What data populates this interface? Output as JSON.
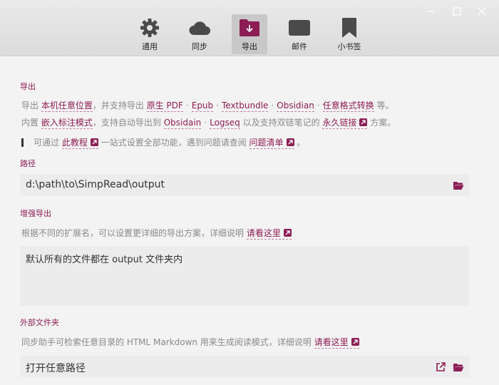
{
  "window": {
    "controls": [
      "minimize",
      "maximize",
      "close"
    ]
  },
  "tabs": [
    {
      "label": "通用",
      "icon": "gear-icon",
      "active": false
    },
    {
      "label": "同步",
      "icon": "cloud-icon",
      "active": false
    },
    {
      "label": "导出",
      "icon": "export-folder-icon",
      "active": true
    },
    {
      "label": "邮件",
      "icon": "mail-icon",
      "active": false
    },
    {
      "label": "小书签",
      "icon": "bookmark-icon",
      "active": false
    }
  ],
  "export": {
    "title": "导出",
    "line1": {
      "prefix": "导出",
      "link1": "本机任意位置",
      "mid": "，并支持导出",
      "formats": [
        "原生 PDF",
        "Epub",
        "Textbundle",
        "Obsidian",
        "任意格式转换"
      ],
      "suffix": "等。"
    },
    "line2": {
      "prefix": "内置",
      "link1": "嵌入标注模式",
      "mid": "，支持自动导出到",
      "link2": "Obsidain",
      "link3": "Logseq",
      "mid2": "以及支持双链笔记的",
      "link4": "永久链接",
      "suffix": "方案。"
    },
    "line3": {
      "prefix": "可通过",
      "link1": "此教程",
      "mid": "一站式设置全部功能，遇到问题请查阅",
      "link2": "问题清单",
      "suffix": "。"
    }
  },
  "path": {
    "title": "路径",
    "value": "d:\\path\\to\\SimpRead\\output",
    "icon": "folder-open-icon"
  },
  "enhanced": {
    "title": "增强导出",
    "desc": "根据不同的扩展名，可以设置更详细的导出方案，详细说明",
    "link": "请看这里",
    "textarea": "默认所有的文件都在 output 文件夹内"
  },
  "external": {
    "title": "外部文件夹",
    "desc": "同步助手可检索任意目录的 HTML Markdown 用来生成阅读模式，详细说明",
    "link": "请看这里",
    "placeholder": "打开任意路径",
    "icons": [
      "external-link-icon",
      "folder-open-icon"
    ]
  },
  "colors": {
    "accent": "#8c1d55",
    "muted_text": "#8a8a8a",
    "field_bg": "#ececec"
  }
}
